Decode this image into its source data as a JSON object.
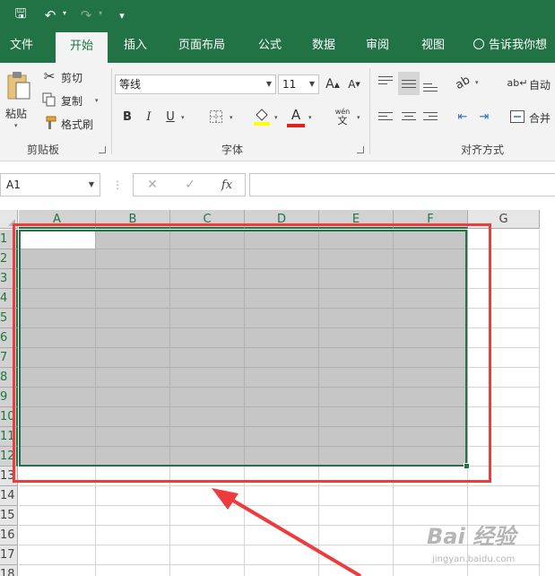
{
  "quick_access": {
    "save": "🖫",
    "undo": "↶",
    "redo": "↷",
    "customize": "▾"
  },
  "tabs": [
    {
      "label": "文件",
      "active": false
    },
    {
      "label": "开始",
      "active": true
    },
    {
      "label": "插入",
      "active": false
    },
    {
      "label": "页面布局",
      "active": false
    },
    {
      "label": "公式",
      "active": false
    },
    {
      "label": "数据",
      "active": false
    },
    {
      "label": "审阅",
      "active": false
    },
    {
      "label": "视图",
      "active": false
    }
  ],
  "tell_me": "告诉我你想",
  "clipboard": {
    "paste": "粘贴",
    "cut": "剪切",
    "copy": "复制",
    "format_painter": "格式刷",
    "group_label": "剪贴板"
  },
  "font": {
    "name": "等线",
    "size": "11",
    "group_label": "字体",
    "bold": "B",
    "italic": "I",
    "underline": "U",
    "grow": "A",
    "shrink": "A",
    "font_color": "A",
    "phonetic_top": "wén",
    "phonetic_bottom": "文"
  },
  "alignment": {
    "wrap_text": "自动",
    "merge": "合并",
    "group_label": "对齐方式"
  },
  "formula_bar": {
    "name_box": "A1",
    "cancel": "✕",
    "enter": "✓",
    "fx": "fx",
    "value": ""
  },
  "sheet": {
    "columns": [
      "A",
      "B",
      "C",
      "D",
      "E",
      "F",
      "G"
    ],
    "rows": [
      "1",
      "2",
      "3",
      "4",
      "5",
      "6",
      "7",
      "8",
      "9",
      "10",
      "11",
      "12",
      "13",
      "14",
      "15",
      "16",
      "17",
      "18"
    ],
    "selected_range": "A1:F12",
    "active_cell": "A1"
  },
  "colors": {
    "accent": "#217346",
    "selection_fill": "#c6c6c6",
    "annotation_red": "#ee3b3b"
  },
  "watermark": {
    "big": "Bai 经验",
    "small": "jingyan.baidu.com"
  }
}
